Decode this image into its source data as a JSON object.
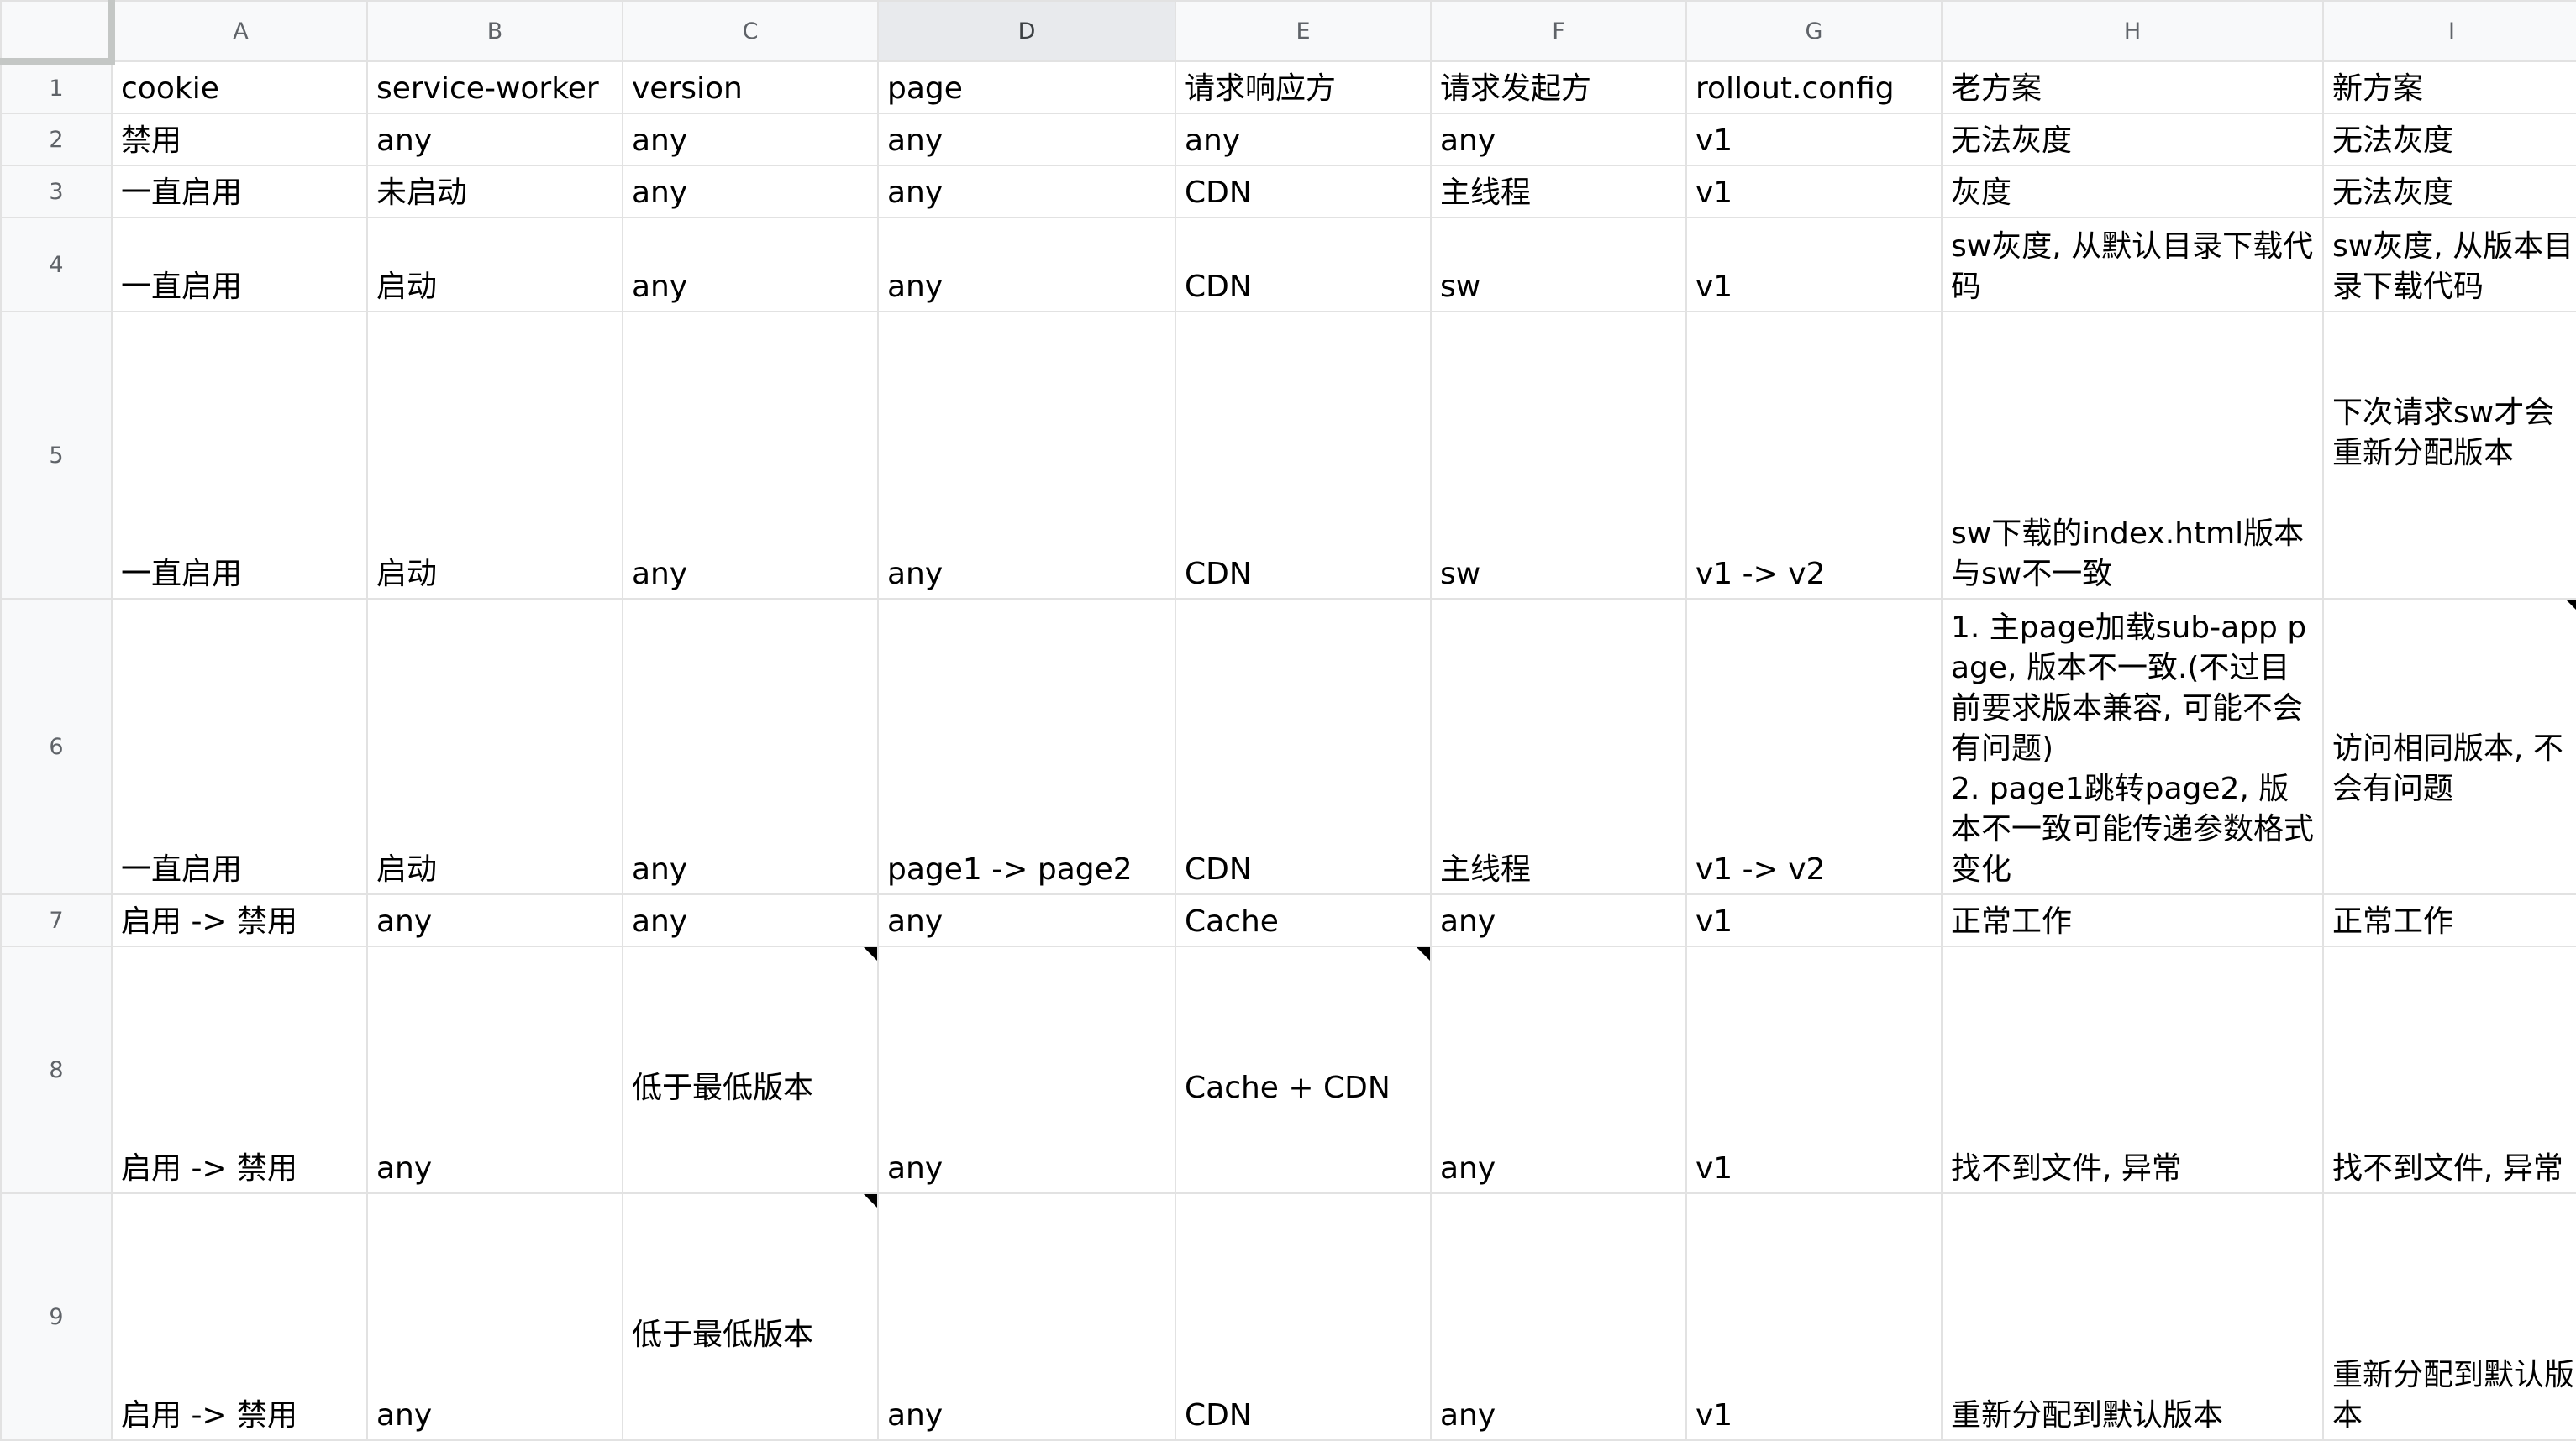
{
  "columns": [
    "A",
    "B",
    "C",
    "D",
    "E",
    "F",
    "G",
    "H",
    "I"
  ],
  "selected_column": "D",
  "rows": [
    {
      "num": "1",
      "cells": [
        "cookie",
        "service-worker",
        "version",
        "page",
        "请求响应方",
        "请求发起方",
        "rollout.config",
        "老方案",
        "新方案"
      ]
    },
    {
      "num": "2",
      "cells": [
        "禁用",
        "any",
        "any",
        "any",
        "any",
        "any",
        "v1",
        "无法灰度",
        "无法灰度"
      ]
    },
    {
      "num": "3",
      "cells": [
        "一直启用",
        "未启动",
        "any",
        "any",
        "CDN",
        "主线程",
        "v1",
        "灰度",
        "无法灰度"
      ]
    },
    {
      "num": "4",
      "cells": [
        "一直启用",
        "启动",
        "any",
        "any",
        "CDN",
        "sw",
        "v1",
        "sw灰度, 从默认目录下载代码",
        "sw灰度, 从版本目录下载代码"
      ]
    },
    {
      "num": "5",
      "cells": [
        "一直启用",
        "启动",
        "any",
        "any",
        "CDN",
        "sw",
        "v1 -> v2",
        "sw下载的index.html版本与sw不一致\n",
        "下次请求sw才会重新分配版本"
      ]
    },
    {
      "num": "6",
      "cells": [
        "一直启用",
        "启动",
        "any",
        "page1 -> page2",
        "CDN",
        "主线程",
        "v1 -> v2",
        "1. 主page加载sub-app page, 版本不一致.(不过目前要求版本兼容, 可能不会有问题)\n2. page1跳转page2, 版本不一致可能传递参数格式变化",
        "访问相同版本, 不会有问题"
      ]
    },
    {
      "num": "7",
      "cells": [
        "启用 -> 禁用",
        "any",
        "any",
        "any",
        "Cache",
        "any",
        "v1",
        "正常工作",
        "正常工作"
      ]
    },
    {
      "num": "8",
      "cells": [
        "启用 -> 禁用",
        "any",
        "低于最低版本",
        "any",
        "Cache + CDN",
        "any",
        "v1",
        "找不到文件, 异常",
        "找不到文件, 异常"
      ]
    },
    {
      "num": "9",
      "cells": [
        "启用 -> 禁用",
        "any",
        "低于最低版本",
        "any",
        "CDN",
        "any",
        "v1",
        "重新分配到默认版本",
        "重新分配到默认版本"
      ]
    }
  ]
}
